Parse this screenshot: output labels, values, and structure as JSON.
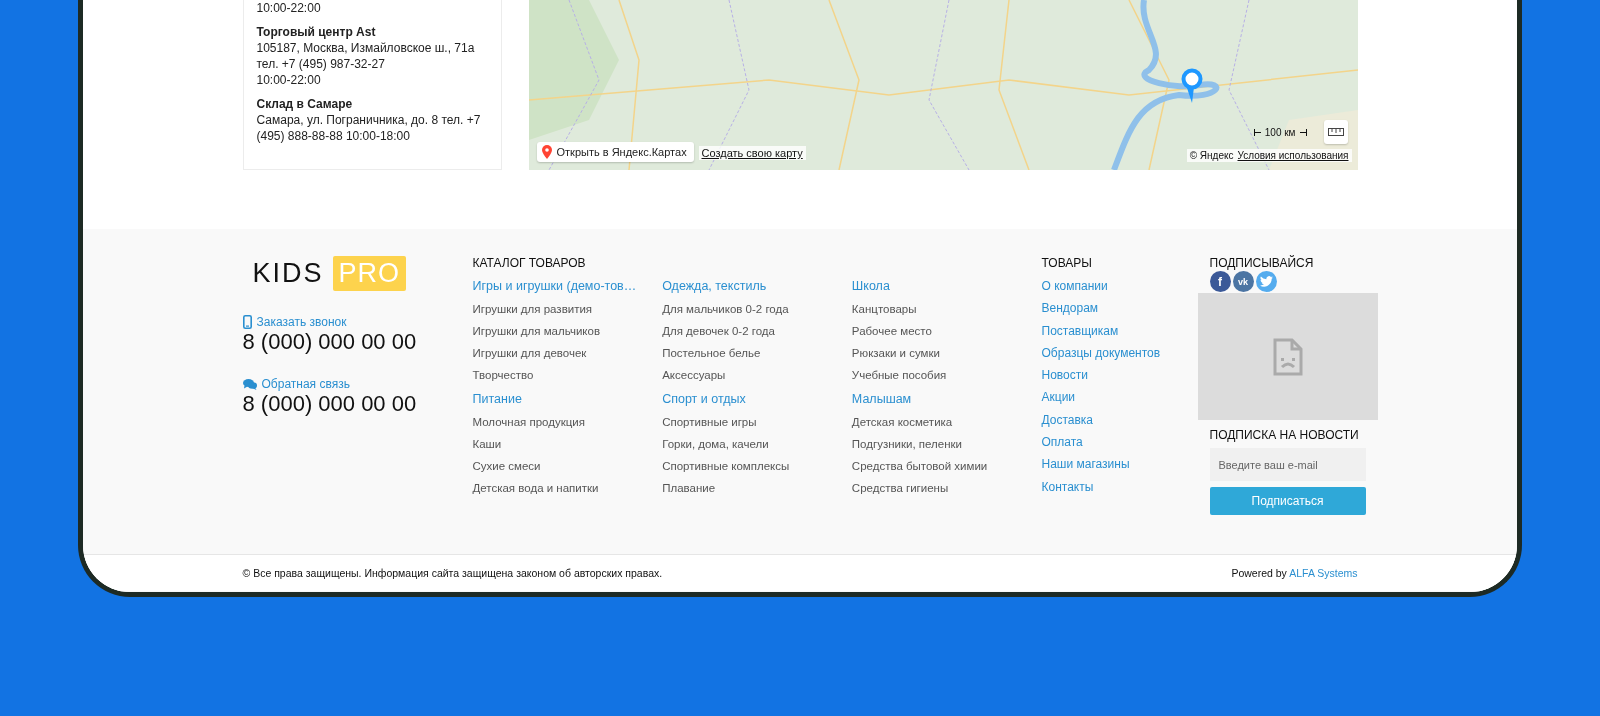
{
  "stores": [
    {
      "lines": [
        "10:00-22:00"
      ]
    },
    {
      "name": "Торговый центр Ast",
      "lines": [
        "105187, Москва, Измайловское ш., 71а",
        "тел. +7 (495) 987-32-27",
        "10:00-22:00"
      ]
    },
    {
      "name": "Склад в Самаре",
      "lines": [
        "Самара, ул. Пограничника, до. 8 тел. +7 (495) 888-88-88 10:00-18:00"
      ]
    }
  ],
  "map": {
    "open_button": "Открыть в Яндекс.Картах",
    "create_link": "Создать свою карту",
    "scale": "100 км",
    "copyright": "© Яндекс",
    "terms_link": "Условия использования"
  },
  "footer": {
    "logo": {
      "text": "KIDS",
      "badge": "PRO"
    },
    "contacts": [
      {
        "kind": "phone",
        "label": "Заказать звонок",
        "number": "8 (000) 000 00 00"
      },
      {
        "kind": "chat",
        "label": "Обратная связь",
        "number": "8 (000) 000 00 00"
      }
    ],
    "catalog": {
      "title": "КАТАЛОГ ТОВАРОВ",
      "columns": [
        [
          {
            "title": "Игры и игрушки (демо-тов…",
            "items": [
              "Игрушки для развития",
              "Игрушки для мальчиков",
              "Игрушки для девочек",
              "Творчество"
            ]
          },
          {
            "title": "Питание",
            "items": [
              "Молочная продукция",
              "Каши",
              "Сухие смеси",
              "Детская вода и напитки"
            ]
          }
        ],
        [
          {
            "title": "Одежда, текстиль",
            "items": [
              "Для мальчиков 0-2 года",
              "Для девочек 0-2 года",
              "Постельное белье",
              "Аксессуары"
            ]
          },
          {
            "title": "Спорт и отдых",
            "items": [
              "Спортивные игры",
              "Горки, дома, качели",
              "Спортивные комплексы",
              "Плавание"
            ]
          }
        ],
        [
          {
            "title": "Школа",
            "items": [
              "Канцтовары",
              "Рабочее место",
              "Рюкзаки и сумки",
              "Учебные пособия"
            ]
          },
          {
            "title": "Малышам",
            "items": [
              "Детская косметика",
              "Подгузники, пеленки",
              "Средства бытовой химии",
              "Средства гигиены"
            ]
          }
        ]
      ]
    },
    "goods": {
      "title": "ТОВАРЫ",
      "links": [
        "О компании",
        "Вендорам",
        "Поставщикам",
        "Образцы документов",
        "Новости",
        "Акции",
        "Доставка",
        "Оплата",
        "Наши магазины",
        "Контакты"
      ]
    },
    "subscribe": {
      "title": "ПОДПИСЫВАЙСЯ",
      "socials": [
        {
          "kind": "facebook",
          "glyph": "f"
        },
        {
          "kind": "vk",
          "glyph": "vk"
        },
        {
          "kind": "twitter"
        }
      ],
      "newsletter_title": "ПОДПИСКА НА НОВОСТИ",
      "placeholder": "Введите ваш e-mail",
      "button": "Подписаться"
    }
  },
  "bottom": {
    "copyright": "© Все права защищены. Информация сайта защищена законом об авторских правах.",
    "powered_by": "Powered by",
    "powered_link": "ALFA Systems"
  }
}
